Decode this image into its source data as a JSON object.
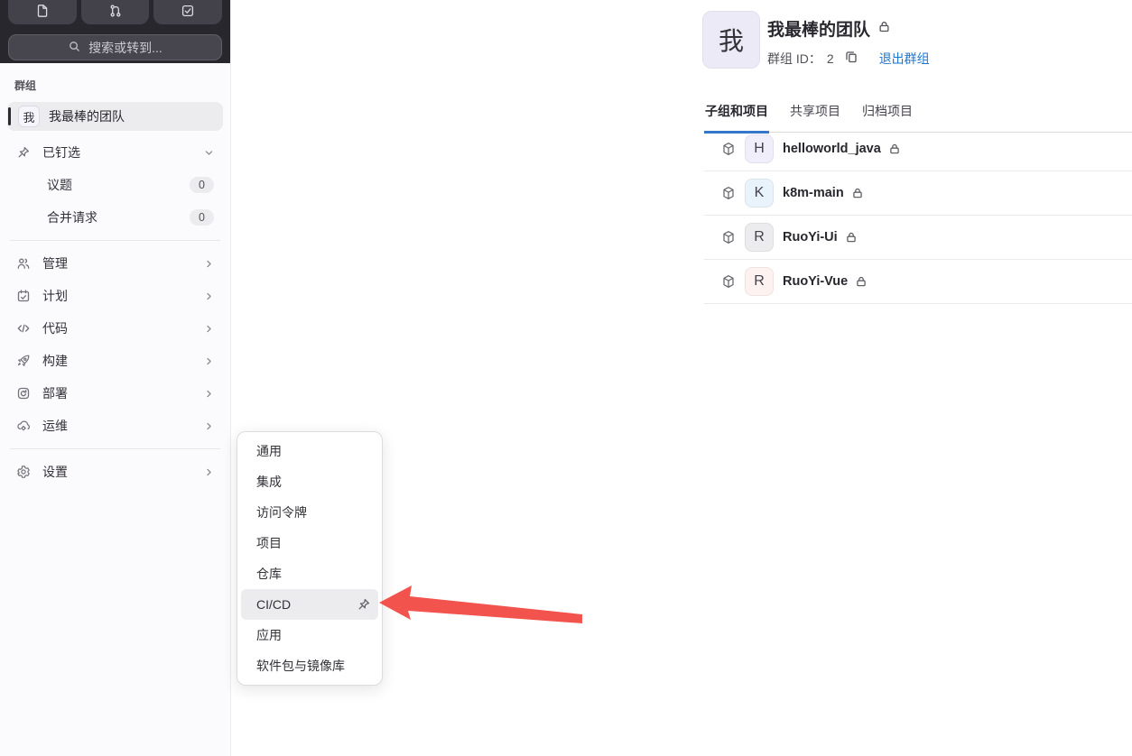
{
  "colors": {
    "topbar_bg": "#28272e",
    "topbar_button_bg": "#434149",
    "sidebar_bg": "#fbfafd",
    "active_item_bg": "#ececef",
    "link_blue": "#1f75cb",
    "tab_underline": "#3477c9",
    "arrow_red": "#f2544d"
  },
  "topbar": {
    "search_placeholder": "搜索或转到...",
    "buttons": [
      {
        "icon": "issues-icon"
      },
      {
        "icon": "merge-request-icon"
      },
      {
        "icon": "todos-icon"
      }
    ]
  },
  "sidebar": {
    "section_label": "群组",
    "context": {
      "avatar_text": "我",
      "title": "我最棒的团队"
    },
    "items": [
      {
        "label": "已钉选",
        "icon": "pin-icon",
        "chevron": "down"
      },
      {
        "label": "议题",
        "badge": "0"
      },
      {
        "label": "合并请求",
        "badge": "0"
      },
      {
        "label": "管理",
        "icon": "users-icon",
        "chevron": "right"
      },
      {
        "label": "计划",
        "icon": "calendar-icon",
        "chevron": "right"
      },
      {
        "label": "代码",
        "icon": "code-icon",
        "chevron": "right"
      },
      {
        "label": "构建",
        "icon": "rocket-icon",
        "chevron": "right"
      },
      {
        "label": "部署",
        "icon": "deploy-icon",
        "chevron": "right"
      },
      {
        "label": "运维",
        "icon": "cloud-gear-icon",
        "chevron": "right"
      },
      {
        "label": "设置",
        "icon": "gear-icon",
        "chevron": "right"
      }
    ]
  },
  "header": {
    "avatar_text": "我",
    "title": "我最棒的团队",
    "visibility_icon": "lock-icon",
    "group_id_label": "群组 ID：",
    "group_id_value": "2",
    "copy_icon": "copy-to-clipboard-icon",
    "leave_group_link": "退出群组"
  },
  "tabs": [
    {
      "label": "子组和项目",
      "active": true
    },
    {
      "label": "共享项目",
      "active": false
    },
    {
      "label": "归档项目",
      "active": false
    }
  ],
  "projects": [
    {
      "name": "helloworld_java",
      "avatar_text": "H",
      "avatar_bg": "#f1eefc"
    },
    {
      "name": "k8m-main",
      "avatar_text": "K",
      "avatar_bg": "#e9f3fb"
    },
    {
      "name": "RuoYi-Ui",
      "avatar_text": "R",
      "avatar_bg": "#ececef"
    },
    {
      "name": "RuoYi-Vue",
      "avatar_text": "R",
      "avatar_bg": "#fdf2f0"
    }
  ],
  "flyout": {
    "items": [
      {
        "label": "通用"
      },
      {
        "label": "集成"
      },
      {
        "label": "访问令牌"
      },
      {
        "label": "项目"
      },
      {
        "label": "仓库"
      },
      {
        "label": "CI/CD",
        "highlighted": true,
        "pin_icon": "pin-icon"
      },
      {
        "label": "应用"
      },
      {
        "label": "软件包与镜像库"
      }
    ]
  },
  "annotation": {
    "type": "arrow",
    "color": "#f2544d",
    "points_to": "CI/CD"
  }
}
